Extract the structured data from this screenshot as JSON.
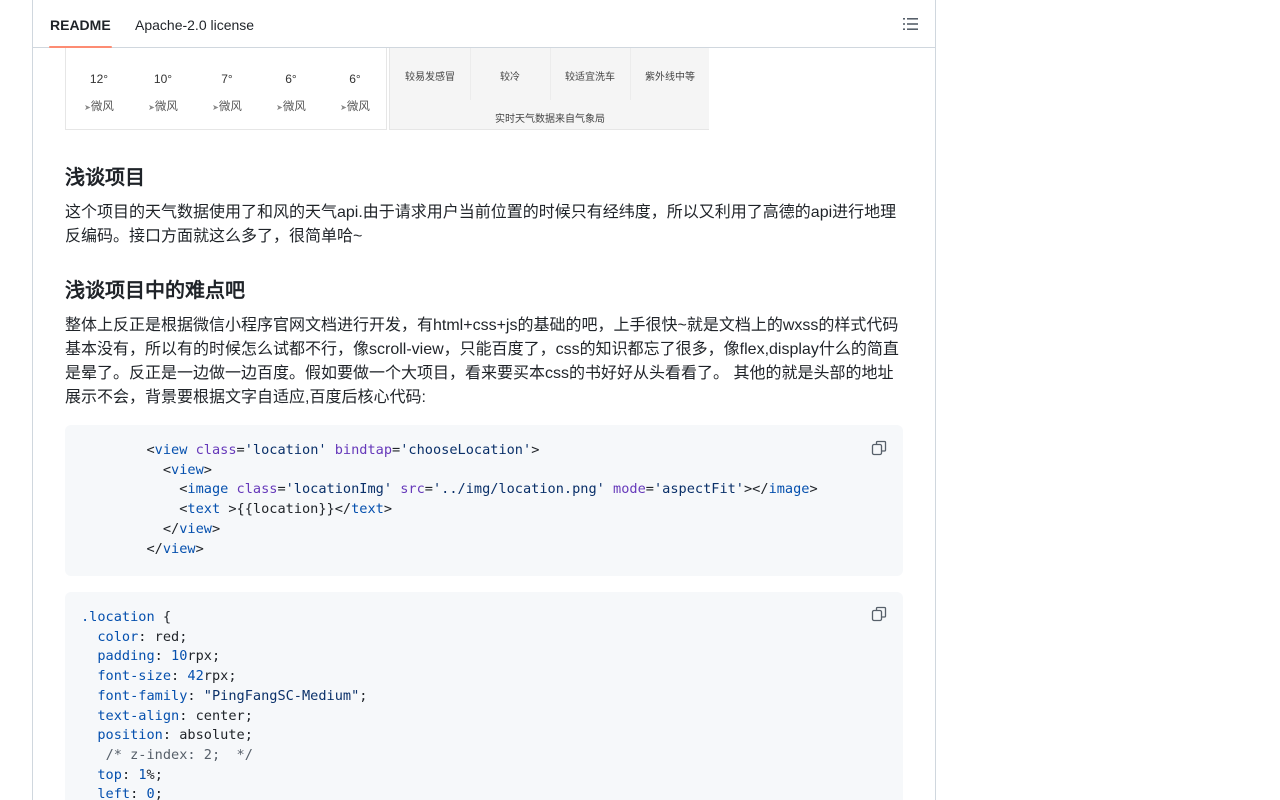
{
  "tabs": {
    "readme": "README",
    "license": "Apache-2.0 license"
  },
  "weather": {
    "hours": [
      {
        "temp": "12°",
        "wind": "微风",
        "icon": "sun-icon"
      },
      {
        "temp": "10°",
        "wind": "微风",
        "icon": "partly-cloudy-icon"
      },
      {
        "temp": "7°",
        "wind": "微风",
        "icon": "partly-cloudy-icon"
      },
      {
        "temp": "6°",
        "wind": "微风",
        "icon": "cloudy-icon"
      },
      {
        "temp": "6°",
        "wind": "微风",
        "icon": "partly-cloudy-icon"
      }
    ],
    "indices": [
      "较易发感冒",
      "较冷",
      "较适宜洗车",
      "紫外线中等"
    ],
    "note": "实时天气数据来自气象局"
  },
  "section1": {
    "heading": "浅谈项目",
    "text": "这个项目的天气数据使用了和风的天气api.由于请求用户当前位置的时候只有经纬度，所以又利用了高德的api进行地理反编码。接口方面就这么多了，很简单哈~"
  },
  "section2": {
    "heading": "浅谈项目中的难点吧",
    "text": "整体上反正是根据微信小程序官网文档进行开发，有html+css+js的基础的吧，上手很快~就是文档上的wxss的样式代码基本没有，所以有的时候怎么试都不行，像scroll-view，只能百度了，css的知识都忘了很多，像flex,display什么的简直是晕了。反正是一边做一边百度。假如要做一个大项目，看来要买本css的书好好从头看看了。 其他的就是头部的地址展示不会，背景要根据文字自适应,百度后核心代码:"
  },
  "code1": {
    "l1a": "<",
    "l1tag": "view",
    "l1attr": "class",
    "l1eq": "=",
    "l1val": "'location'",
    "l1attr2": "bindtap",
    "l1val2": "'chooseLocation'",
    "l1end": ">",
    "l2a": "<",
    "l2tag": "view",
    "l2end": ">",
    "l3a": "<",
    "l3tag": "image",
    "l3attr": "class",
    "l3val": "'locationImg'",
    "l3attr2": "src",
    "l3val2": "'../img/location.png'",
    "l3attr3": "mode",
    "l3val3": "'aspectFit'",
    "l3mid": "></",
    "l3tag2": "image",
    "l3end": ">",
    "l4a": "<",
    "l4tag": "text",
    "l4mid": " >{{location}}</",
    "l4tag2": "text",
    "l4end": ">",
    "l5a": "</",
    "l5tag": "view",
    "l5end": ">",
    "l6a": "</",
    "l6tag": "view",
    "l6end": ">"
  },
  "code2": {
    "selector": ".location",
    "open": " {",
    "lines": [
      {
        "prop": "color",
        "val": "red",
        "num": ""
      },
      {
        "prop": "padding",
        "num": "10",
        "val": "rpx"
      },
      {
        "prop": "font-size",
        "num": "42",
        "val": "rpx"
      },
      {
        "prop": "font-family",
        "val": "\"PingFangSC-Medium\"",
        "num": ""
      },
      {
        "prop": "text-align",
        "val": "center",
        "num": ""
      },
      {
        "prop": "position",
        "val": "absolute",
        "num": ""
      }
    ],
    "comment": "/* z-index: 2;  */",
    "top_prop": "top",
    "top_num": "1",
    "top_unit": "%",
    "left_prop": "left",
    "left_num": "0"
  }
}
